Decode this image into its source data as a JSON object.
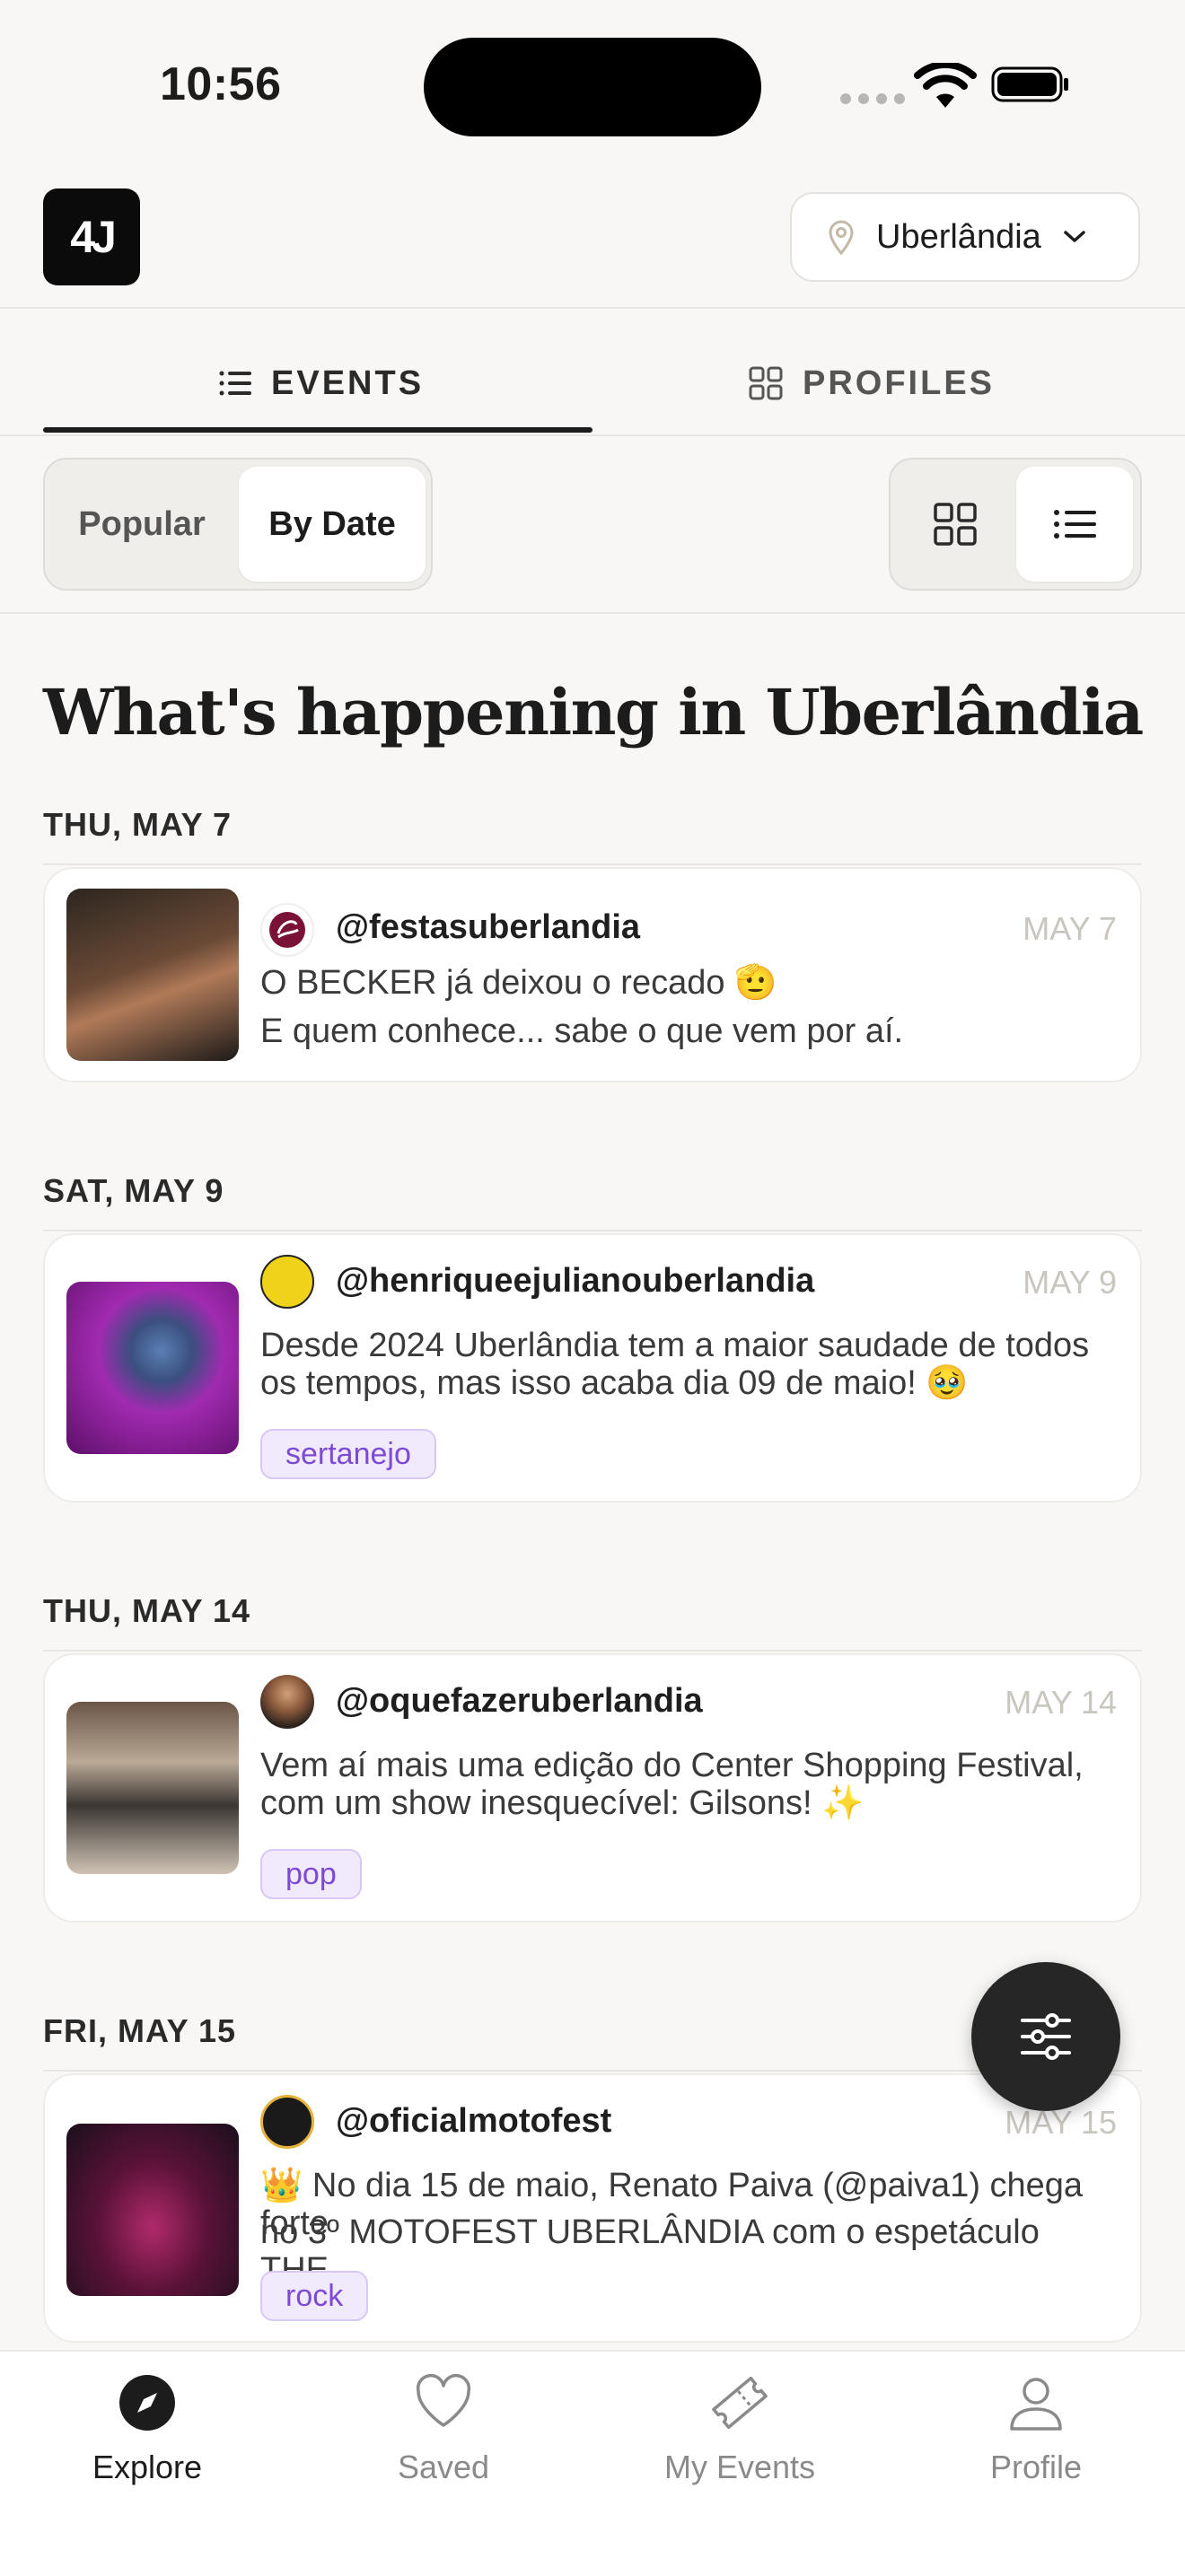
{
  "status_bar": {
    "time": "10:56"
  },
  "header": {
    "logo_text": "4J",
    "city": "Uberlândia"
  },
  "tabs": [
    {
      "label": "EVENTS",
      "icon": "list-icon",
      "active": true
    },
    {
      "label": "PROFILES",
      "icon": "grid-icon",
      "active": false
    }
  ],
  "sort": {
    "options": [
      "Popular",
      "By Date"
    ],
    "selected": "By Date"
  },
  "view_toggle": {
    "options": [
      "grid-icon",
      "list-icon"
    ],
    "selected": "list-icon"
  },
  "page_title": "What's happening in Uberlândia",
  "sections": [
    {
      "date_label": "THU, MAY 7",
      "events": [
        {
          "handle": "@festasuberlandia",
          "date": "MAY 7",
          "description_lines": [
            "O BECKER já deixou o recado 🫡",
            "E quem conhece... sabe o que vem por aí."
          ],
          "tag": null,
          "thumb_color": "#3a2c22"
        }
      ]
    },
    {
      "date_label": "SAT, MAY 9",
      "events": [
        {
          "handle": "@henriqueejulianouberlandia",
          "date": "MAY 9",
          "description_lines": [
            "Desde 2024 Uberlândia tem a maior saudade de todos",
            "os tempos, mas isso acaba dia 09 de maio! 🥹"
          ],
          "tag": "sertanejo",
          "thumb_color": "#8a1f9a"
        }
      ]
    },
    {
      "date_label": "THU, MAY 14",
      "events": [
        {
          "handle": "@oquefazeruberlandia",
          "date": "MAY 14",
          "description_lines": [
            "Vem aí mais uma edição do Center Shopping Festival,",
            "com um show inesquecível: Gilsons! ✨"
          ],
          "tag": "pop",
          "thumb_color": "#7c6a5a"
        }
      ]
    },
    {
      "date_label": "FRI, MAY 15",
      "events": [
        {
          "handle": "@oficialmotofest",
          "date": "MAY 15",
          "description_lines": [
            "👑 No dia 15 de maio, Renato Paiva (@paiva1) chega forte",
            "no 3º MOTOFEST UBERLÂNDIA com o espetáculo THE..."
          ],
          "tag": "rock",
          "thumb_color": "#4a1a3a"
        }
      ]
    }
  ],
  "bottom_nav": [
    {
      "label": "Explore",
      "icon": "compass-icon",
      "active": true
    },
    {
      "label": "Saved",
      "icon": "heart-icon",
      "active": false
    },
    {
      "label": "My Events",
      "icon": "ticket-icon",
      "active": false
    },
    {
      "label": "Profile",
      "icon": "person-icon",
      "active": false
    }
  ],
  "colors": {
    "tag_text": "#7d4ad6",
    "tag_bg": "#f1eafd",
    "background": "#f8f7f5"
  }
}
